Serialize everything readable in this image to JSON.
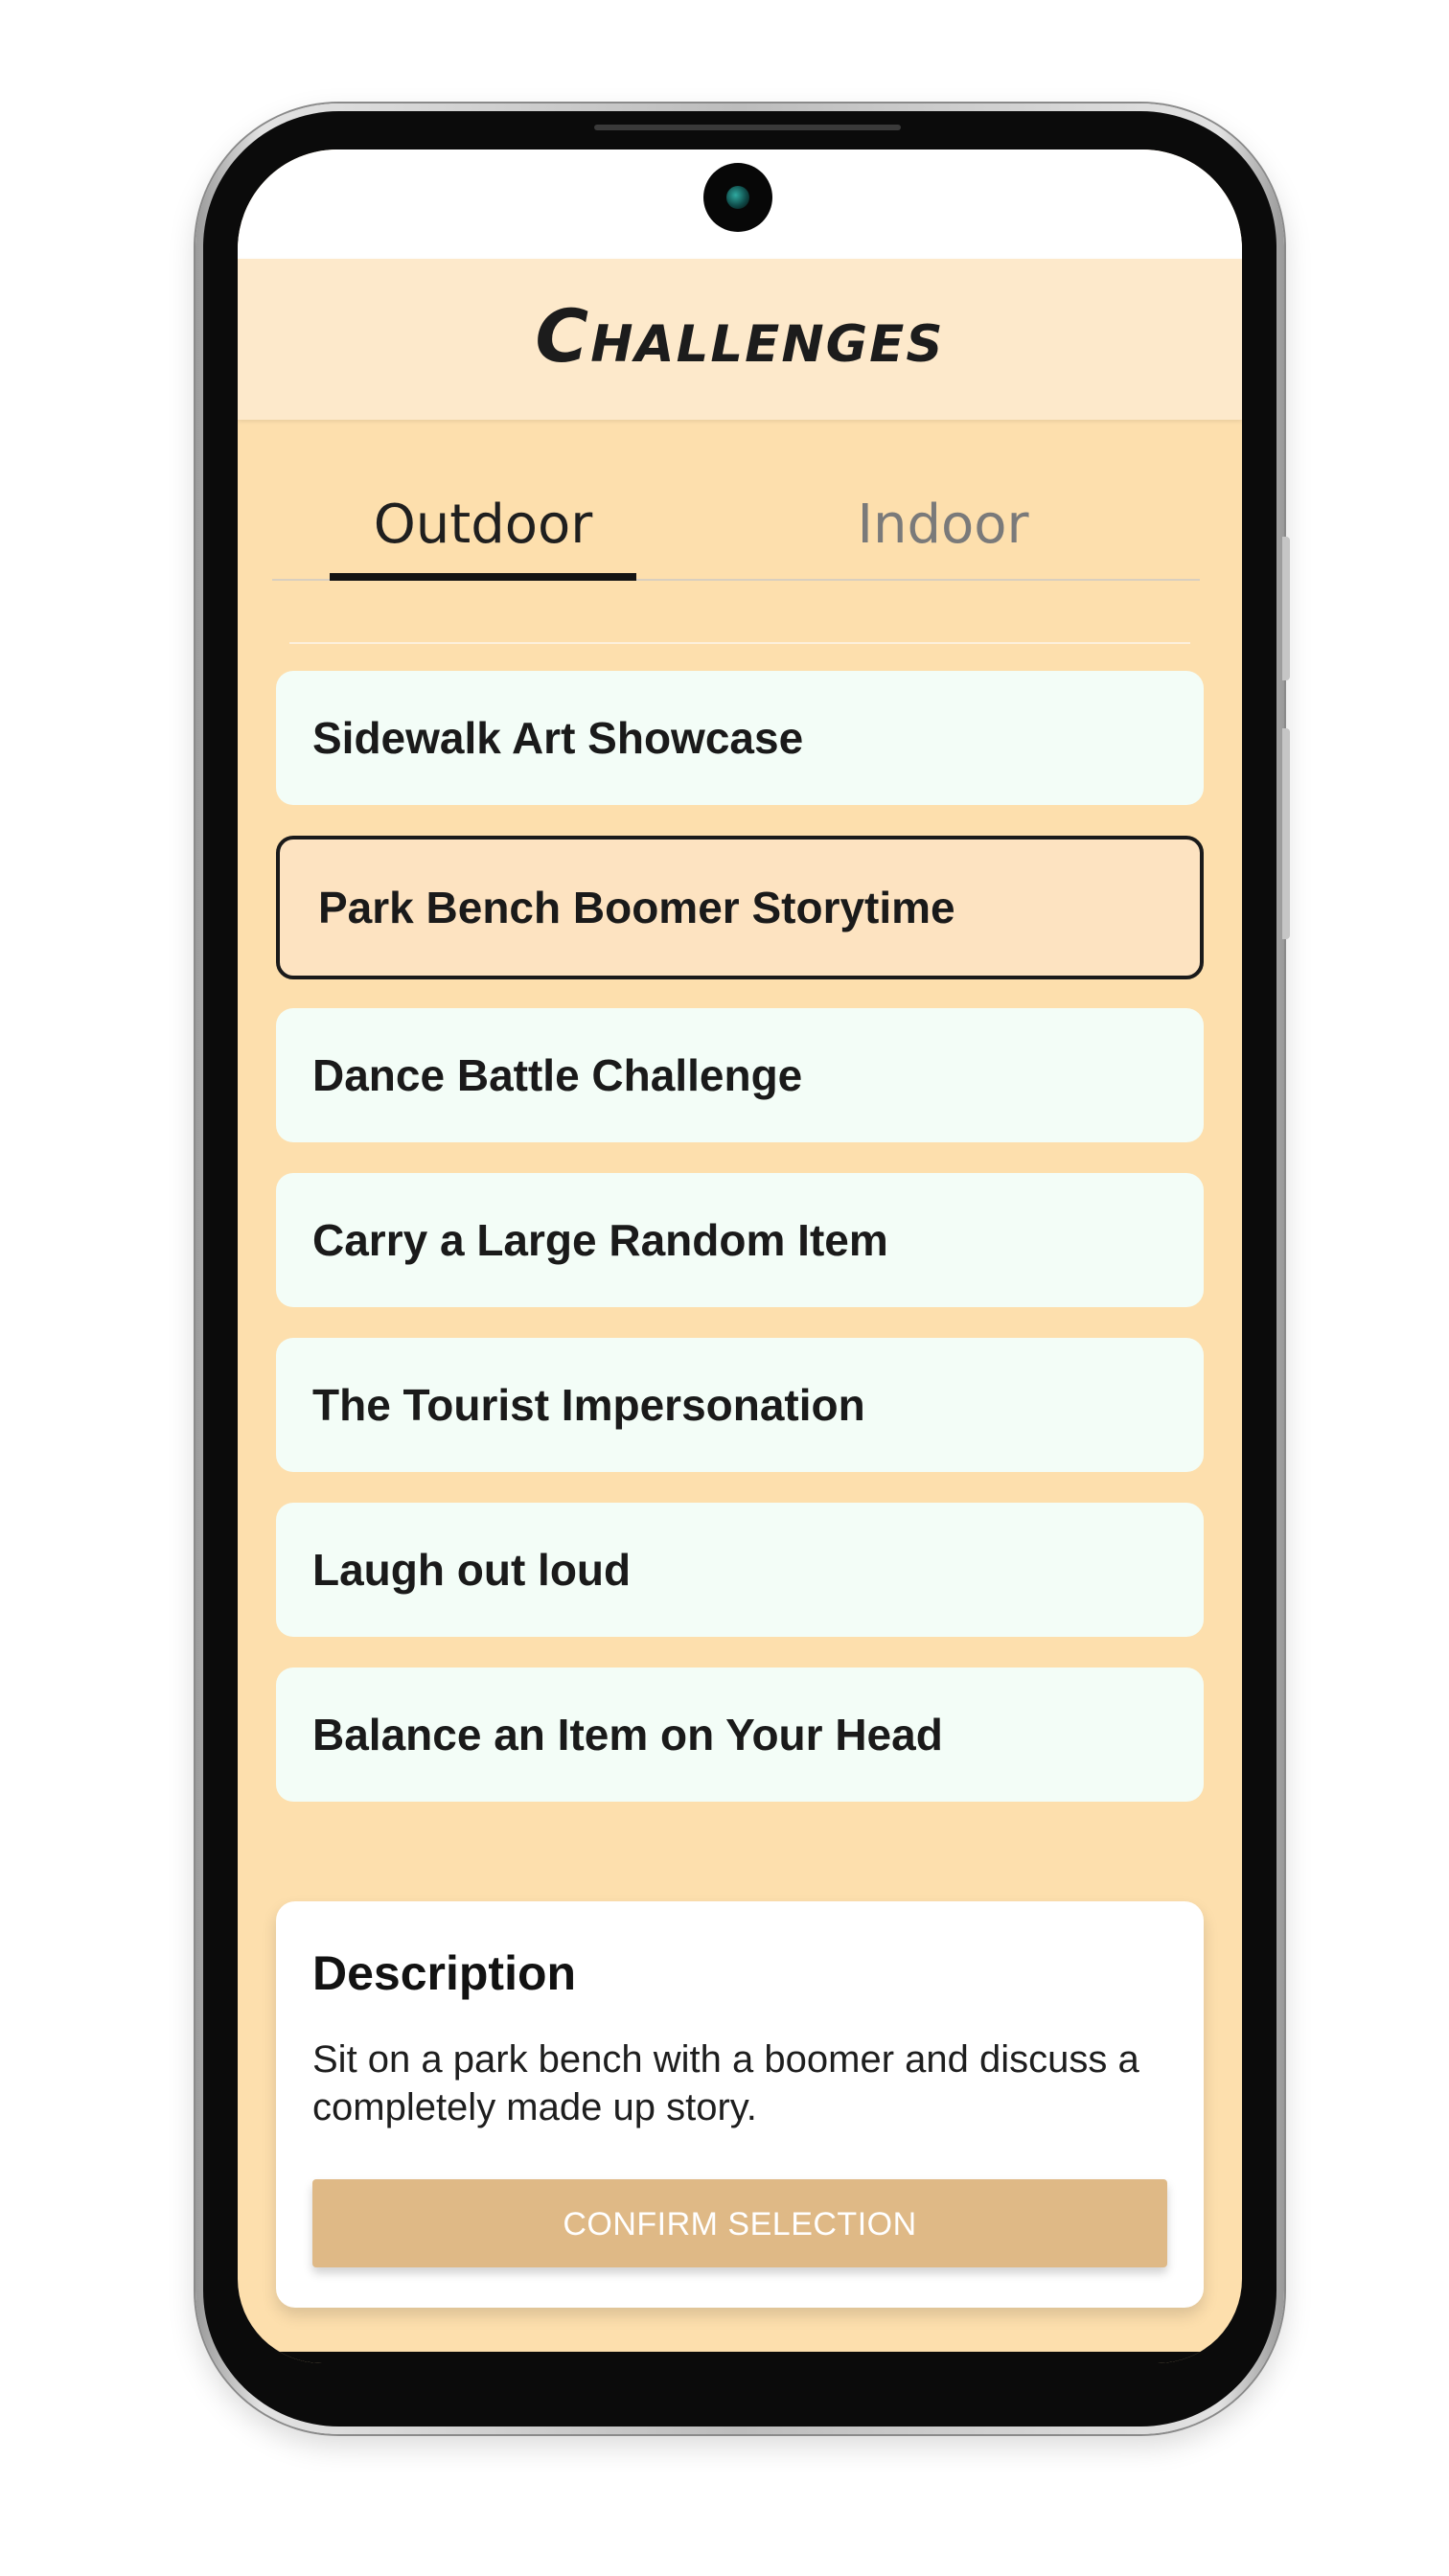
{
  "app": {
    "title": "Challenges"
  },
  "tabs": [
    {
      "label": "Outdoor",
      "active": true
    },
    {
      "label": "Indoor",
      "active": false
    }
  ],
  "challenges": [
    {
      "label": "Sidewalk Art Showcase",
      "selected": false
    },
    {
      "label": "Park Bench Boomer Storytime",
      "selected": true
    },
    {
      "label": "Dance Battle Challenge",
      "selected": false
    },
    {
      "label": "Carry a Large Random Item",
      "selected": false
    },
    {
      "label": "The Tourist Impersonation",
      "selected": false
    },
    {
      "label": "Laugh out loud",
      "selected": false
    },
    {
      "label": "Balance an Item on Your Head",
      "selected": false
    }
  ],
  "description": {
    "title": "Description",
    "text": "Sit on a park bench with a boomer and discuss a completely made up story.",
    "button_label": "CONFIRM SELECTION"
  },
  "colors": {
    "background": "#fddfad",
    "header": "#fde9cb",
    "item": "#f3fdf7",
    "item_selected": "#fde3c1",
    "button": "#dfb986"
  },
  "icons": {
    "camera": "front-camera-icon"
  }
}
